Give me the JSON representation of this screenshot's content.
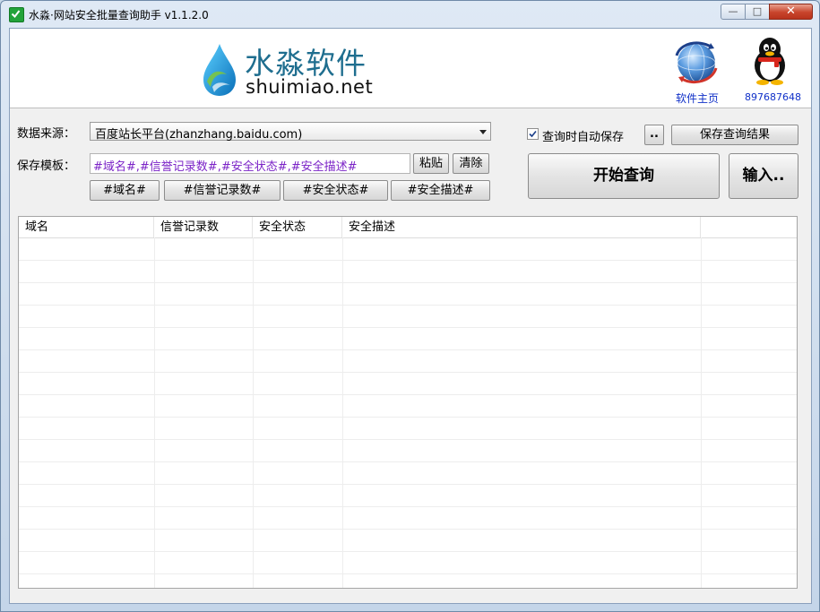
{
  "window": {
    "title": "水淼·网站安全批量查询助手 v1.1.2.0",
    "controls": {
      "minimize": "—",
      "maximize": "□",
      "close": "✕"
    }
  },
  "banner": {
    "logo_cn": "水淼软件",
    "logo_en": "shuimiao.net",
    "home_link": "软件主页",
    "qq_number": "897687648",
    "icons": [
      "water-drop-logo",
      "globe-icon",
      "qq-penguin-icon"
    ]
  },
  "form": {
    "source_label": "数据来源：",
    "source_value": "百度站长平台(zhanzhang.baidu.com)",
    "template_label": "保存模板：",
    "template_value": "#域名#,#信誉记录数#,#安全状态#,#安全描述#",
    "paste_button": "粘贴",
    "clear_button": "清除",
    "tag_buttons": [
      "#域名#",
      "#信誉记录数#",
      "#安全状态#",
      "#安全描述#"
    ],
    "auto_save_label": "查询时自动保存",
    "auto_save_checked": true,
    "browse_button": "..",
    "save_results_button": "保存查询结果",
    "start_button": "开始查询",
    "input_button": "输入.."
  },
  "grid": {
    "columns": [
      "域名",
      "信誉记录数",
      "安全状态",
      "安全描述",
      ""
    ],
    "rows": []
  },
  "colors": {
    "template_text": "#7b23c7",
    "link": "#1030c8",
    "logo_text": "#1f6e8f",
    "close_button": "#c8442b"
  }
}
